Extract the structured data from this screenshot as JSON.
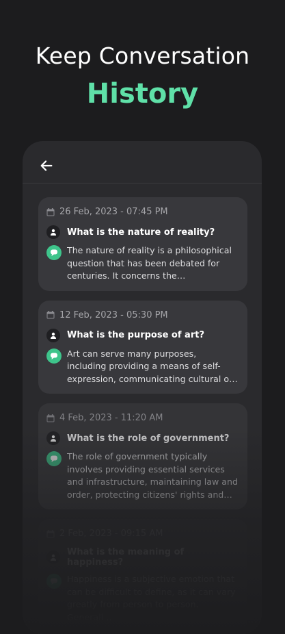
{
  "hero": {
    "line1": "Keep Conversation",
    "line2": "History"
  },
  "colors": {
    "accent": "#5fe0a8",
    "bot_icon": "#3ec48b",
    "background": "#1c1c1e",
    "card": "#38383c"
  },
  "icons": {
    "back": "back-arrow-icon",
    "date": "calendar-icon",
    "user": "user-icon",
    "bot": "chat-bubble-icon"
  },
  "history": [
    {
      "date": "26 Feb, 2023 - 07:45 PM",
      "question": "What is the nature of reality?",
      "answer": "The nature of reality is a philosophical question that has been debated for centuries. It concerns the fundamental…"
    },
    {
      "date": "12 Feb, 2023 - 05:30 PM",
      "question": "What is the purpose of art?",
      "answer": "Art can serve many purposes, including providing a means of self-expression, communicating cultural or social values…"
    },
    {
      "date": "4 Feb, 2023 - 11:20 AM",
      "question": "What is the role of government?",
      "answer": "The role of government typically involves providing essential services and infrastructure, maintaining law and order, protecting citizens' rights and fr…"
    },
    {
      "date": "2 Feb, 2023 - 09:15 AM",
      "question": "What is the meaning of happiness?",
      "answer": "Happiness is a subjective emotion that can be difficult to define, as it can vary greatly from person to person. Generall…"
    }
  ]
}
